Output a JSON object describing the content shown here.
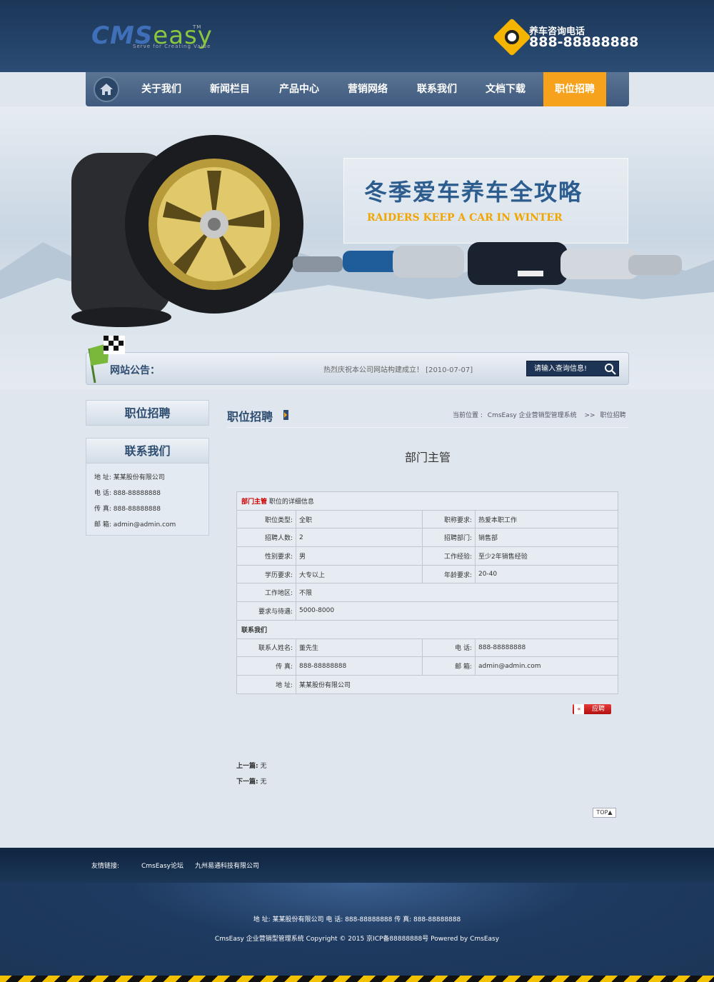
{
  "header": {
    "logo_text_a": "CMS",
    "logo_text_b": "easy",
    "logo_tm": "TM",
    "logo_slogan": "Serve for Creating Value",
    "hotline_label": "养车咨询电话",
    "hotline_number": "888-88888888"
  },
  "nav": {
    "items": [
      "关于我们",
      "新闻栏目",
      "产品中心",
      "营销网络",
      "联系我们",
      "文档下载",
      "职位招聘"
    ],
    "active_index": 6,
    "active_color": "#f7a21c"
  },
  "banner": {
    "title": "冬季爱车养车全攻略",
    "subtitle": "RAIDERS KEEP A CAR IN WINTER"
  },
  "notice": {
    "label": "网站公告：",
    "text": "热烈庆祝本公司网站构建成立！  [2010-07-07]",
    "search_placeholder": "请输入查询信息!"
  },
  "sidebar": {
    "heading_jobs": "职位招聘",
    "heading_contact": "联系我们",
    "contact": {
      "address": "地 址: 某某股份有限公司",
      "phone": "电 话: 888-88888888",
      "fax": "传 真: 888-88888888",
      "email": "邮 箱: admin@admin.com"
    }
  },
  "main": {
    "title": "职位招聘",
    "breadcrumb": {
      "label": "当前位置 :",
      "home": "CmsEasy 企业营销型管理系统",
      "sep": ">>",
      "current": "职位招聘"
    },
    "job_title": "部门主管",
    "table": {
      "header_red": "部门主管",
      "header_rest": " 职位的详细信息",
      "rows": [
        {
          "l1": "职位类型:",
          "v1": "全职",
          "l2": "职称要求:",
          "v2": "热爱本职工作"
        },
        {
          "l1": "招聘人数:",
          "v1": "2",
          "l2": "招聘部门:",
          "v2": "销售部"
        },
        {
          "l1": "性别要求:",
          "v1": "男",
          "l2": "工作经验:",
          "v2": "至少2年销售经验"
        },
        {
          "l1": "学历要求:",
          "v1": "大专以上",
          "l2": "年龄要求:",
          "v2": "20-40"
        }
      ],
      "location_label": "工作地区:",
      "location_value": "不限",
      "salary_label": "要求与待遇:",
      "salary_value": "5000-8000",
      "contact_section": "联系我们",
      "contact_rows": [
        {
          "l1": "联系人姓名:",
          "v1": "董先生",
          "l2": "电 话:",
          "v2": "888-88888888"
        },
        {
          "l1": "传 真:",
          "v1": "888-88888888",
          "l2": "邮 箱:",
          "v2": "admin@admin.com"
        }
      ],
      "address_label": "地 址:",
      "address_value": "某某股份有限公司"
    },
    "apply_label": "应聘",
    "prev_label": "上一篇:",
    "prev_value": "无",
    "next_label": "下一篇:",
    "next_value": "无",
    "top_label": "TOP"
  },
  "footer": {
    "links_label": "友情链接:",
    "links": [
      "CmsEasy论坛",
      "九州易通科技有限公司"
    ],
    "info": "地 址: 某某股份有限公司   电 话: 888-88888888   传 真: 888-88888888",
    "copyright": "CmsEasy 企业营销型管理系统 Copyright © 2015 京ICP备88888888号 Powered by CmsEasy"
  },
  "colors": {
    "header_bg": "#1b3657",
    "accent": "#f7a21c",
    "title_blue": "#2d4c70",
    "apply_red": "#c81d1d"
  }
}
